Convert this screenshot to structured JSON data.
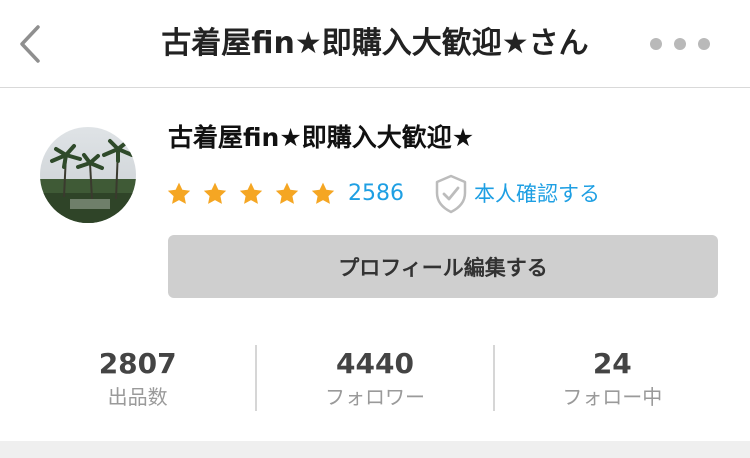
{
  "nav": {
    "title": "古着屋fin★即購入大歓迎★さん",
    "back_icon": "chevron-left-icon",
    "more_icon": "more-horizontal-icon"
  },
  "profile": {
    "name": "古着屋fin★即購入大歓迎★",
    "avatar_description": "palm-trees-photo",
    "rating": {
      "stars": 5,
      "max": 5,
      "star_color": "#f5a623",
      "count": "2586"
    },
    "verify": {
      "label": "本人確認する",
      "icon": "shield-check-icon"
    },
    "edit_button": "プロフィール編集する"
  },
  "stats": [
    {
      "value": "2807",
      "label": "出品数"
    },
    {
      "value": "4440",
      "label": "フォロワー"
    },
    {
      "value": "24",
      "label": "フォロー中"
    }
  ],
  "colors": {
    "accent": "#1e9fe3",
    "star": "#f5a623",
    "button_bg": "#cfcfcf"
  }
}
